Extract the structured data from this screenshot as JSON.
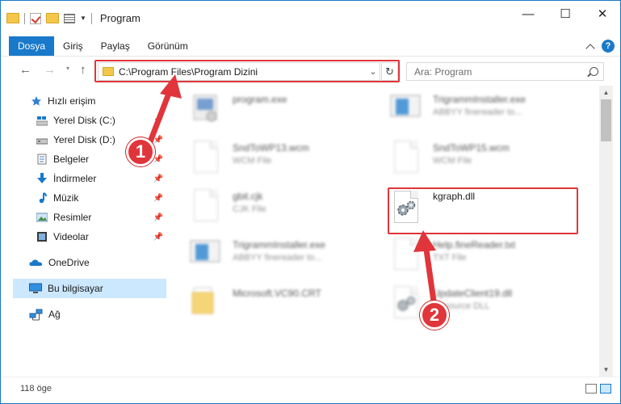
{
  "window": {
    "title": "Program",
    "minimize_glyph": "—",
    "maximize_glyph": "☐",
    "close_glyph": "✕"
  },
  "ribbon": {
    "tabs": [
      {
        "label": "Dosya"
      },
      {
        "label": "Giriş"
      },
      {
        "label": "Paylaş"
      },
      {
        "label": "Görünüm"
      }
    ],
    "help_glyph": "?"
  },
  "navigation": {
    "back_glyph": "←",
    "forward_glyph": "→",
    "up_glyph": "↑",
    "recent_glyph": "▾",
    "address": "C:\\Program Files\\Program Dizini",
    "address_dropdown_glyph": "⌄",
    "refresh_glyph": "↻",
    "search_placeholder": "Ara: Program"
  },
  "sidebar": {
    "pin_glyph": "📌",
    "items": [
      {
        "label": "Hızlı erişim",
        "icon": "star-icon"
      },
      {
        "label": "Yerel Disk (C:)",
        "icon": "drive-c-icon",
        "pinned": true
      },
      {
        "label": "Yerel Disk (D:)",
        "icon": "drive-d-icon",
        "pinned": true
      },
      {
        "label": "Belgeler",
        "icon": "documents-icon",
        "pinned": true
      },
      {
        "label": "İndirmeler",
        "icon": "downloads-icon",
        "pinned": true
      },
      {
        "label": "Müzik",
        "icon": "music-icon",
        "pinned": true
      },
      {
        "label": "Resimler",
        "icon": "pictures-icon",
        "pinned": true
      },
      {
        "label": "Videolar",
        "icon": "videos-icon",
        "pinned": true
      },
      {
        "label": "OneDrive",
        "icon": "onedrive-icon"
      },
      {
        "label": "Bu bilgisayar",
        "icon": "this-pc-icon",
        "selected": true
      },
      {
        "label": "Ağ",
        "icon": "network-icon"
      }
    ]
  },
  "files": [
    {
      "name": "program.exe",
      "desc": "",
      "icon": "exe-icon"
    },
    {
      "name": "TrigrammInstaller.exe",
      "desc": "ABBYY finereader to...",
      "icon": "installer-icon"
    },
    {
      "name": "SndToWP13.wcm",
      "desc": "WCM File",
      "icon": "file-icon"
    },
    {
      "name": "SndToWP15.wcm",
      "desc": "WCM File",
      "icon": "file-icon"
    },
    {
      "name": "gbit.cjk",
      "desc": "CJK File",
      "icon": "file-icon"
    },
    {
      "name": "kgraph.dll",
      "desc": "",
      "icon": "dll-gear-icon"
    },
    {
      "name": "TrigrammInstaller.exe",
      "desc": "ABBYY finereader to...",
      "icon": "installer-icon"
    },
    {
      "name": "Help.fineReader.txt",
      "desc": "TXT File",
      "icon": "text-file-icon"
    },
    {
      "name": "Microsoft.VC90.CRT",
      "desc": "",
      "icon": "folder-icon"
    },
    {
      "name": "UpdateClient19.dll",
      "desc": "Resource DLL",
      "icon": "dll-gear-icon"
    }
  ],
  "callouts": {
    "step1": "1",
    "step2": "2"
  },
  "status": {
    "item_count": "118 öge"
  },
  "colors": {
    "accent": "#1979ca",
    "highlight": "#e0353b",
    "selection": "#cce8ff"
  }
}
